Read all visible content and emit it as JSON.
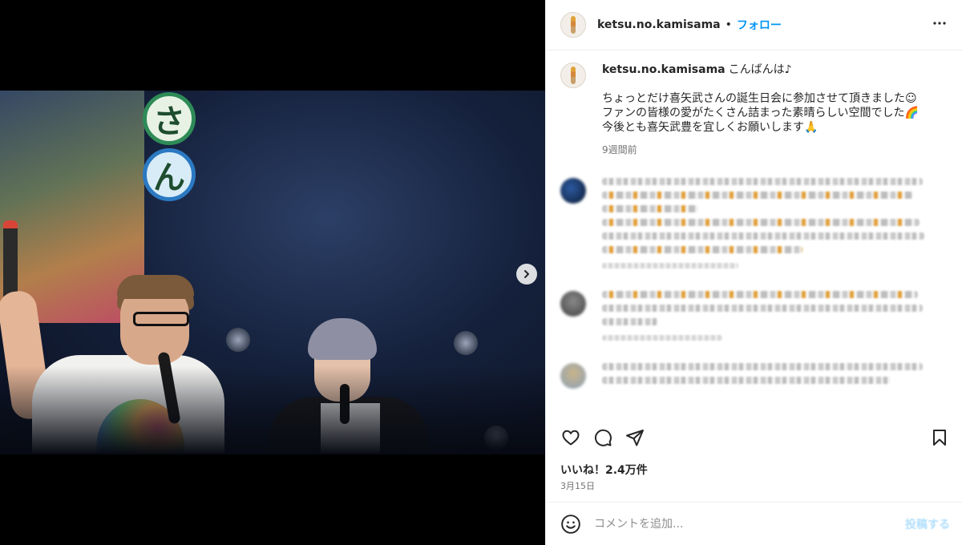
{
  "post": {
    "username": "ketsu.no.kamisama",
    "separator": "•",
    "follow_label": "フォロー",
    "more_icon": "more-horizontal-icon"
  },
  "caption": {
    "username": "ketsu.no.kamisama",
    "greeting": "こんばんは♪",
    "lines": [
      "ちょっとだけ喜矢武さんの誕生日会に参加させて頂きました☺",
      "ファンの皆様の愛がたくさん詰まった素晴らしい空間でした🌈",
      "今後とも喜矢武豊を宜しくお願いします🙏"
    ],
    "time": "9週間前"
  },
  "photo": {
    "sign_letters": [
      "さ",
      "ん"
    ]
  },
  "actions": {
    "like_icon": "heart-icon",
    "comment_icon": "comment-icon",
    "share_icon": "share-icon",
    "save_icon": "bookmark-icon"
  },
  "likes_text": "いいね！2.4万件",
  "date": "3月15日",
  "comment_box": {
    "placeholder": "コメントを追加...",
    "post_label": "投稿する"
  },
  "colors": {
    "accent": "#0095f6",
    "text": "#262626",
    "muted": "#737373",
    "border": "#efefef"
  }
}
